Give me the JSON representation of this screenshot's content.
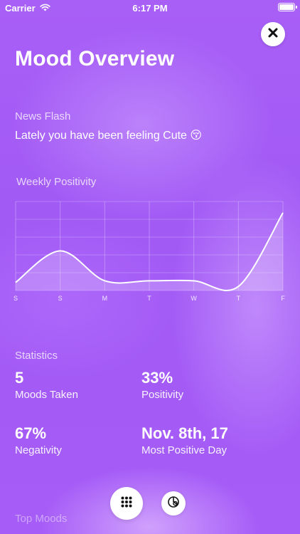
{
  "status_bar": {
    "carrier": "Carrier",
    "time": "6:17 PM"
  },
  "header": {
    "title": "Mood Overview",
    "close_icon": "close-icon"
  },
  "news_flash": {
    "label": "News Flash",
    "text": "Lately you have been feeling Cute 😚"
  },
  "weekly_positivity": {
    "label": "Weekly Positivity"
  },
  "chart_data": {
    "type": "area",
    "categories": [
      "S",
      "S",
      "M",
      "T",
      "W",
      "T",
      "F"
    ],
    "values": [
      0.0,
      0.39,
      0.02,
      0.02,
      0.02,
      -0.05,
      0.86
    ],
    "ylim": [
      -0.1,
      1.0
    ],
    "grid": true,
    "line_color": "#ffffff",
    "fill_color": "rgba(255,255,255,0.22)"
  },
  "statistics": {
    "label": "Statistics",
    "items": [
      {
        "value": "5",
        "label": "Moods Taken"
      },
      {
        "value": "33%",
        "label": "Positivity"
      },
      {
        "value": "67%",
        "label": "Negativity"
      },
      {
        "value": "Nov. 8th, 17",
        "label": "Most Positive Day"
      }
    ]
  },
  "bottom_bar": {
    "grid_icon": "grid-icon",
    "chart_icon": "pie-chart-icon"
  },
  "top_moods": {
    "label": "Top Moods"
  },
  "colors": {
    "background": "#a45cf4",
    "text": "#ffffff"
  }
}
